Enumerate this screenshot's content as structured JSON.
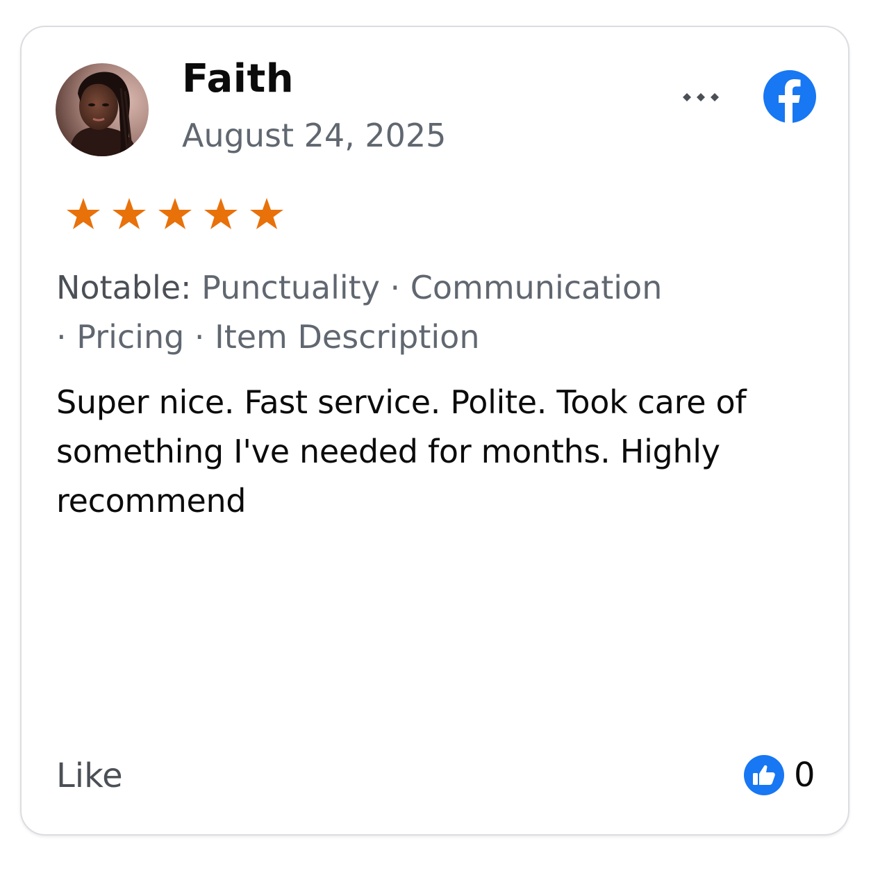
{
  "review": {
    "reviewer_name": "Faith",
    "date": "August 24, 2025",
    "rating": 5,
    "rating_max": 5,
    "notable_label": "Notable:",
    "notable_items_line1": " Punctuality · Communication",
    "notable_items_line2": "· Pricing · Item Description",
    "text": "Super nice. Fast service. Polite. Took care of something I've needed for months. Highly recommend",
    "like_label": "Like",
    "like_count": "0"
  },
  "icons": {
    "more": "more-horizontal-icon",
    "platform": "facebook-icon",
    "star": "star-icon",
    "reaction": "thumbs-up-icon"
  },
  "colors": {
    "star": "#E8710A",
    "facebook_blue": "#1877F2",
    "secondary_text": "#606770",
    "primary_text": "#0B0B0B"
  }
}
